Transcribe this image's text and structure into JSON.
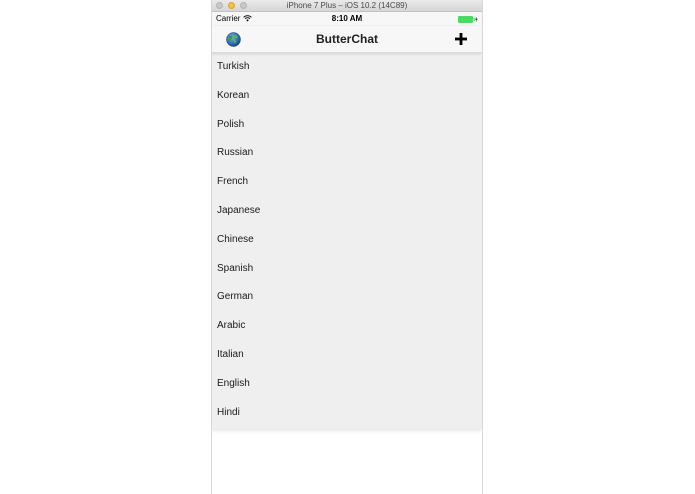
{
  "window": {
    "title": "iPhone 7 Plus – iOS 10.2 (14C89)"
  },
  "status_bar": {
    "carrier": "Carrier",
    "time": "8:10 AM",
    "battery_color": "#4cd964"
  },
  "nav_bar": {
    "title": "ButterChat",
    "left_icon": "globe-icon",
    "right_icon": "add-icon"
  },
  "languages": [
    "Turkish",
    "Korean",
    "Polish",
    "Russian",
    "French",
    "Japanese",
    "Chinese",
    "Spanish",
    "German",
    "Arabic",
    "Italian",
    "English",
    "Hindi"
  ]
}
